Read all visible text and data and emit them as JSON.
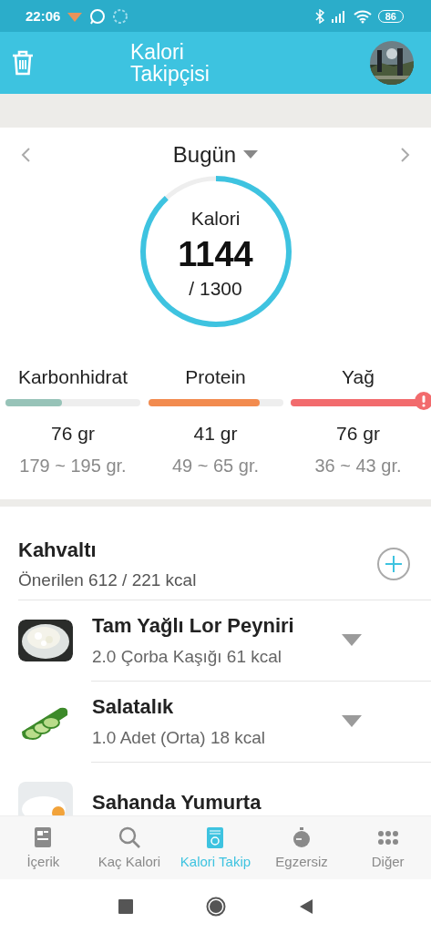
{
  "status_bar": {
    "time": "22:06",
    "battery": "86"
  },
  "app_bar": {
    "title": "Kalori Takipçisi"
  },
  "date_nav": {
    "label": "Bugün"
  },
  "calories": {
    "label": "Kalori",
    "value": "1144",
    "goal": "/ 1300"
  },
  "macros": [
    {
      "name": "Karbonhidrat",
      "level": 0.42,
      "color": "#97c3b8",
      "over": false,
      "amount": "76 gr",
      "range": "179 ~ 195 gr."
    },
    {
      "name": "Protein",
      "level": 0.83,
      "color": "#f28b4f",
      "over": false,
      "amount": "41 gr",
      "range": "49 ~ 65 gr."
    },
    {
      "name": "Yağ",
      "level": 1,
      "color": "#f26b6d",
      "over": true,
      "amount": "76 gr",
      "range": "36 ~ 43 gr."
    }
  ],
  "meal": {
    "title": "Kahvaltı",
    "subtitle": "Önerilen 612 / 221 kcal",
    "items": [
      {
        "name": "Tam Yağlı Lor Peyniri",
        "detail": "2.0 Çorba Kaşığı 61 kcal",
        "kind": "cheese"
      },
      {
        "name": "Salatalık",
        "detail": "1.0 Adet (Orta) 18 kcal",
        "kind": "cucumber"
      },
      {
        "name": "Sahanda Yumurta",
        "kind": "egg"
      }
    ]
  },
  "tabs": [
    {
      "label": "İçerik",
      "selected": false
    },
    {
      "label": "Kaç Kalori",
      "selected": false
    },
    {
      "label": "Kalori Takip",
      "selected": true
    },
    {
      "label": "Egzersiz",
      "selected": false
    },
    {
      "label": "Diğer",
      "selected": false
    }
  ]
}
